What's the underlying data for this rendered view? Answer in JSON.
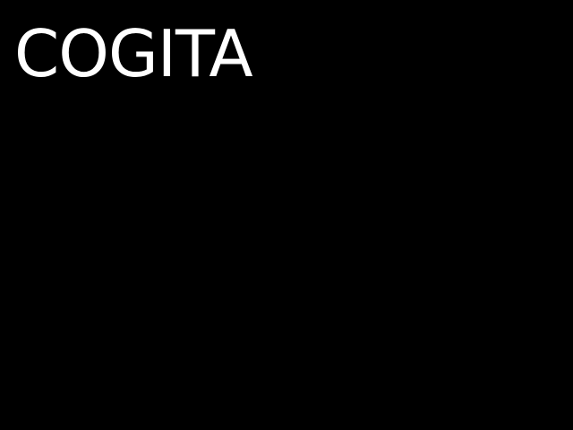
{
  "screen": {
    "title": "COGITA",
    "background_color": "#000000",
    "text_color": "#ffffff"
  }
}
